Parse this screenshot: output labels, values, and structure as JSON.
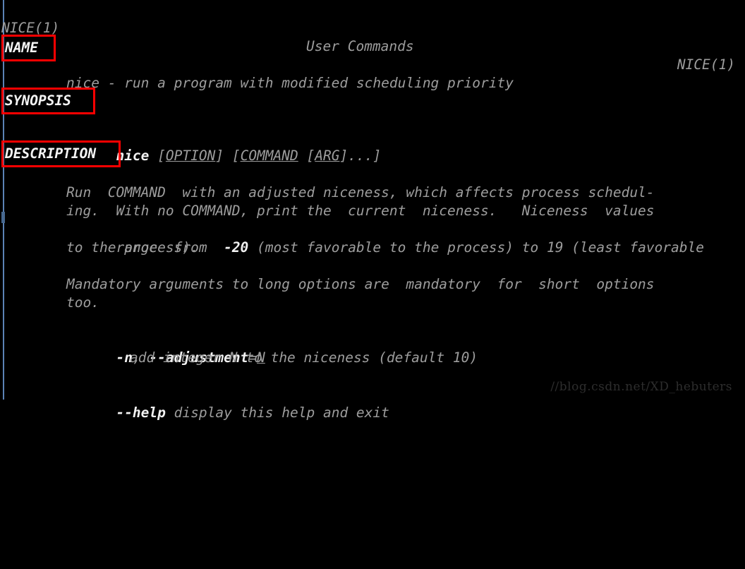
{
  "terminal": {
    "background_color": "#000000",
    "text_color": "#9d9d9d",
    "bold_color": "#f2f2f2",
    "annotation_color": "#fe0000",
    "rail_color": "#5b82b5"
  },
  "header": {
    "left": "NICE(1)",
    "center": "User Commands",
    "right": "NICE(1)"
  },
  "sections": {
    "name": {
      "heading": "NAME",
      "body": "nice - run a program with modified scheduling priority"
    },
    "synopsis": {
      "heading": "SYNOPSIS",
      "command": "nice",
      "option_open": " [",
      "option_word": "OPTION",
      "option_close": "] [",
      "command_word": "COMMAND",
      "arg_mid": " [",
      "arg_word": "ARG",
      "arg_close": "]...]"
    },
    "description": {
      "heading": "DESCRIPTION",
      "para1_line1_a": "Run  COMMAND  with an adjusted niceness, which affects process schedul-",
      "para1_line2": "ing.  With no COMMAND, print the  current  niceness.   Niceness  values",
      "para1_line3_a": "range  from  ",
      "para1_line3_bold": "-20",
      "para1_line3_b": " (most favorable to the process) to 19 (least favorable",
      "para1_line4": "to the process).",
      "para2_line1": "Mandatory arguments to long options are  mandatory  for  short  options",
      "para2_line2": "too.",
      "opt_n_bold_1": "-n",
      "opt_n_sep": ", ",
      "opt_n_bold_2": "--adjustment",
      "opt_n_eq": "=",
      "opt_n_arg": "N",
      "opt_n_desc": "add integer N to the niceness (default 10)",
      "opt_help_bold": "--help",
      "opt_help_desc": " display this help and exit"
    }
  },
  "watermark": {
    "text": "//blog.csdn.net/XD_hebuters"
  }
}
